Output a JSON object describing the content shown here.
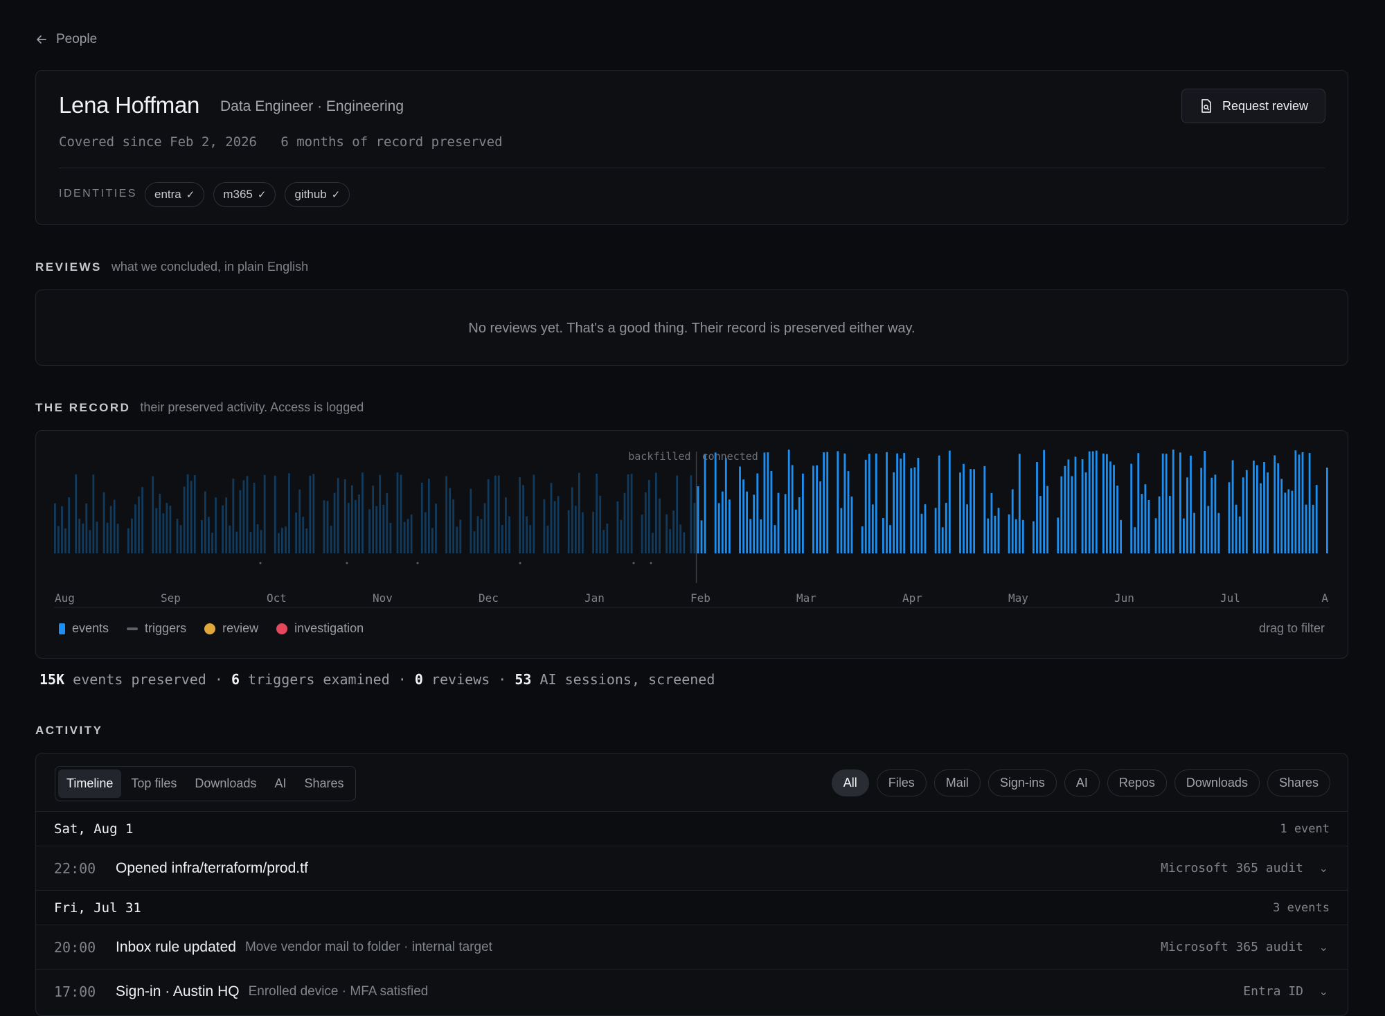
{
  "back": {
    "label": "People"
  },
  "profile": {
    "name": "Lena Hoffman",
    "role": "Data Engineer · Engineering",
    "covered_since": "Covered since Feb 2, 2026",
    "preserved": "6 months of record preserved",
    "identities_label": "IDENTITIES",
    "identities": [
      "entra",
      "m365",
      "github"
    ],
    "check": "✓",
    "request_review": "Request review"
  },
  "reviews": {
    "title": "REVIEWS",
    "subtitle": "what we concluded, in plain English",
    "empty": "No reviews yet. That's a good thing. Their record is preserved either way."
  },
  "record": {
    "title": "THE RECORD",
    "subtitle": "their preserved activity. Access is logged",
    "legend": [
      "events",
      "triggers",
      "review",
      "investigation"
    ],
    "legend_colors": {
      "events": "#1d8ff0",
      "triggers": "#5d6068",
      "review": "#e0a83a",
      "investigation": "#e5485d"
    },
    "drag_hint": "drag to filter"
  },
  "chart_data": {
    "type": "bar",
    "title": "",
    "x_ticks": [
      "Aug",
      "Sep",
      "Oct",
      "Nov",
      "Dec",
      "Jan",
      "Feb",
      "Mar",
      "Apr",
      "May",
      "Jun",
      "Jul",
      "A"
    ],
    "annotations": [
      "backfilled",
      "connected"
    ],
    "series": [
      {
        "name": "backfilled",
        "color": "#123a5c",
        "segment": "Aug–Feb"
      },
      {
        "name": "connected",
        "color": "#1d8ff0",
        "segment": "Feb–Aug"
      }
    ],
    "grid": false,
    "legend": "bottom-left"
  },
  "stats": {
    "events_value": "15K",
    "events_label": " events preserved · ",
    "triggers_value": "6",
    "triggers_label": " triggers examined · ",
    "reviews_value": "0",
    "reviews_label": " reviews · ",
    "ai_value": "53",
    "ai_label": " AI sessions, screened"
  },
  "activity": {
    "title": "ACTIVITY",
    "tabs": [
      "Timeline",
      "Top files",
      "Downloads",
      "AI",
      "Shares"
    ],
    "active_tab": "Timeline",
    "filters": [
      "All",
      "Files",
      "Mail",
      "Sign-ins",
      "AI",
      "Repos",
      "Downloads",
      "Shares"
    ],
    "active_filter": "All",
    "days": [
      {
        "label": "Sat, Aug 1",
        "count": "1 event",
        "events": [
          {
            "time": "22:00",
            "title": "Opened infra/terraform/prod.tf",
            "sub": "",
            "source": "Microsoft 365 audit"
          }
        ]
      },
      {
        "label": "Fri, Jul 31",
        "count": "3 events",
        "events": [
          {
            "time": "20:00",
            "title": "Inbox rule updated",
            "sub": "Move vendor mail to folder · internal target",
            "source": "Microsoft 365 audit"
          },
          {
            "time": "17:00",
            "title": "Sign-in · Austin HQ",
            "sub": "Enrolled device · MFA satisfied",
            "source": "Entra ID"
          }
        ]
      }
    ],
    "chevron": "⌄"
  }
}
